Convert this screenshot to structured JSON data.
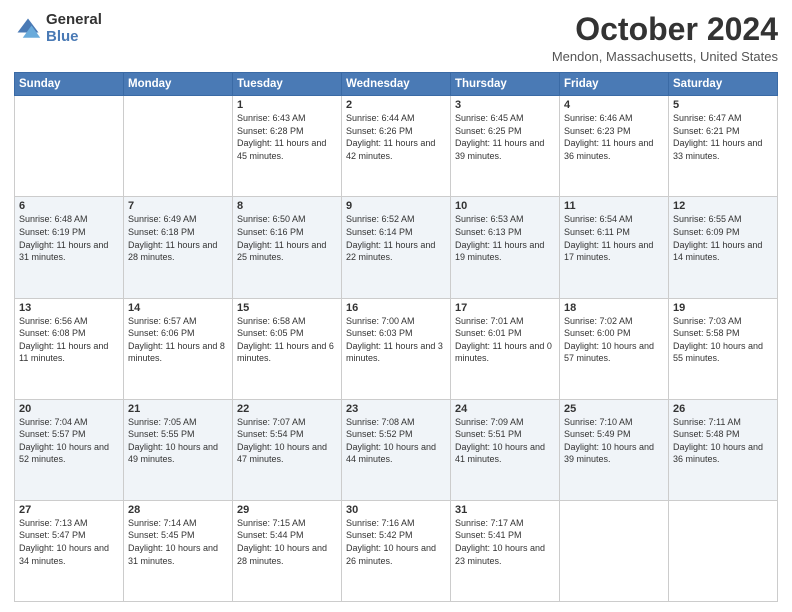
{
  "logo": {
    "general": "General",
    "blue": "Blue"
  },
  "header": {
    "month": "October 2024",
    "location": "Mendon, Massachusetts, United States"
  },
  "weekdays": [
    "Sunday",
    "Monday",
    "Tuesday",
    "Wednesday",
    "Thursday",
    "Friday",
    "Saturday"
  ],
  "weeks": [
    [
      {
        "day": "",
        "info": ""
      },
      {
        "day": "",
        "info": ""
      },
      {
        "day": "1",
        "info": "Sunrise: 6:43 AM\nSunset: 6:28 PM\nDaylight: 11 hours and 45 minutes."
      },
      {
        "day": "2",
        "info": "Sunrise: 6:44 AM\nSunset: 6:26 PM\nDaylight: 11 hours and 42 minutes."
      },
      {
        "day": "3",
        "info": "Sunrise: 6:45 AM\nSunset: 6:25 PM\nDaylight: 11 hours and 39 minutes."
      },
      {
        "day": "4",
        "info": "Sunrise: 6:46 AM\nSunset: 6:23 PM\nDaylight: 11 hours and 36 minutes."
      },
      {
        "day": "5",
        "info": "Sunrise: 6:47 AM\nSunset: 6:21 PM\nDaylight: 11 hours and 33 minutes."
      }
    ],
    [
      {
        "day": "6",
        "info": "Sunrise: 6:48 AM\nSunset: 6:19 PM\nDaylight: 11 hours and 31 minutes."
      },
      {
        "day": "7",
        "info": "Sunrise: 6:49 AM\nSunset: 6:18 PM\nDaylight: 11 hours and 28 minutes."
      },
      {
        "day": "8",
        "info": "Sunrise: 6:50 AM\nSunset: 6:16 PM\nDaylight: 11 hours and 25 minutes."
      },
      {
        "day": "9",
        "info": "Sunrise: 6:52 AM\nSunset: 6:14 PM\nDaylight: 11 hours and 22 minutes."
      },
      {
        "day": "10",
        "info": "Sunrise: 6:53 AM\nSunset: 6:13 PM\nDaylight: 11 hours and 19 minutes."
      },
      {
        "day": "11",
        "info": "Sunrise: 6:54 AM\nSunset: 6:11 PM\nDaylight: 11 hours and 17 minutes."
      },
      {
        "day": "12",
        "info": "Sunrise: 6:55 AM\nSunset: 6:09 PM\nDaylight: 11 hours and 14 minutes."
      }
    ],
    [
      {
        "day": "13",
        "info": "Sunrise: 6:56 AM\nSunset: 6:08 PM\nDaylight: 11 hours and 11 minutes."
      },
      {
        "day": "14",
        "info": "Sunrise: 6:57 AM\nSunset: 6:06 PM\nDaylight: 11 hours and 8 minutes."
      },
      {
        "day": "15",
        "info": "Sunrise: 6:58 AM\nSunset: 6:05 PM\nDaylight: 11 hours and 6 minutes."
      },
      {
        "day": "16",
        "info": "Sunrise: 7:00 AM\nSunset: 6:03 PM\nDaylight: 11 hours and 3 minutes."
      },
      {
        "day": "17",
        "info": "Sunrise: 7:01 AM\nSunset: 6:01 PM\nDaylight: 11 hours and 0 minutes."
      },
      {
        "day": "18",
        "info": "Sunrise: 7:02 AM\nSunset: 6:00 PM\nDaylight: 10 hours and 57 minutes."
      },
      {
        "day": "19",
        "info": "Sunrise: 7:03 AM\nSunset: 5:58 PM\nDaylight: 10 hours and 55 minutes."
      }
    ],
    [
      {
        "day": "20",
        "info": "Sunrise: 7:04 AM\nSunset: 5:57 PM\nDaylight: 10 hours and 52 minutes."
      },
      {
        "day": "21",
        "info": "Sunrise: 7:05 AM\nSunset: 5:55 PM\nDaylight: 10 hours and 49 minutes."
      },
      {
        "day": "22",
        "info": "Sunrise: 7:07 AM\nSunset: 5:54 PM\nDaylight: 10 hours and 47 minutes."
      },
      {
        "day": "23",
        "info": "Sunrise: 7:08 AM\nSunset: 5:52 PM\nDaylight: 10 hours and 44 minutes."
      },
      {
        "day": "24",
        "info": "Sunrise: 7:09 AM\nSunset: 5:51 PM\nDaylight: 10 hours and 41 minutes."
      },
      {
        "day": "25",
        "info": "Sunrise: 7:10 AM\nSunset: 5:49 PM\nDaylight: 10 hours and 39 minutes."
      },
      {
        "day": "26",
        "info": "Sunrise: 7:11 AM\nSunset: 5:48 PM\nDaylight: 10 hours and 36 minutes."
      }
    ],
    [
      {
        "day": "27",
        "info": "Sunrise: 7:13 AM\nSunset: 5:47 PM\nDaylight: 10 hours and 34 minutes."
      },
      {
        "day": "28",
        "info": "Sunrise: 7:14 AM\nSunset: 5:45 PM\nDaylight: 10 hours and 31 minutes."
      },
      {
        "day": "29",
        "info": "Sunrise: 7:15 AM\nSunset: 5:44 PM\nDaylight: 10 hours and 28 minutes."
      },
      {
        "day": "30",
        "info": "Sunrise: 7:16 AM\nSunset: 5:42 PM\nDaylight: 10 hours and 26 minutes."
      },
      {
        "day": "31",
        "info": "Sunrise: 7:17 AM\nSunset: 5:41 PM\nDaylight: 10 hours and 23 minutes."
      },
      {
        "day": "",
        "info": ""
      },
      {
        "day": "",
        "info": ""
      }
    ]
  ]
}
